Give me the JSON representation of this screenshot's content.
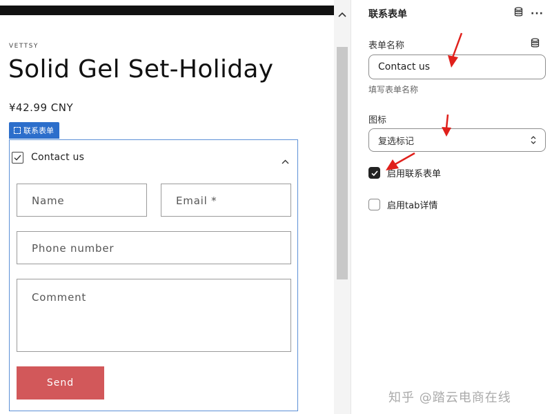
{
  "preview": {
    "vendor": "VETTSY",
    "product_title": "Solid Gel Set-Holiday",
    "price": "¥42.99 CNY",
    "block_tag": "联系表单",
    "form": {
      "title": "Contact us",
      "fields": {
        "name": "Name",
        "email": "Email *",
        "phone": "Phone number",
        "comment": "Comment"
      },
      "send_label": "Send"
    }
  },
  "panel": {
    "title": "联系表单",
    "more": "···",
    "form_name": {
      "label": "表单名称",
      "value": "Contact us",
      "hint": "填写表单名称"
    },
    "icon": {
      "label": "图标",
      "selected": "复选标记"
    },
    "checkboxes": [
      {
        "label": "启用联系表单",
        "checked": true
      },
      {
        "label": "启用tab详情",
        "checked": false
      }
    ],
    "watermark": "知乎 @踏云电商在线"
  },
  "icons": {
    "form_header": "checkbox-icon",
    "collapse": "chevron-up-icon",
    "select": "select-chevron-icon",
    "db": "database-icon",
    "annotation": "red-arrow"
  },
  "colors": {
    "send_button": "#d2585a",
    "block_tag": "#2c6ecb",
    "form_border": "#5b8fd6",
    "annotation_arrow": "#e0201b"
  }
}
